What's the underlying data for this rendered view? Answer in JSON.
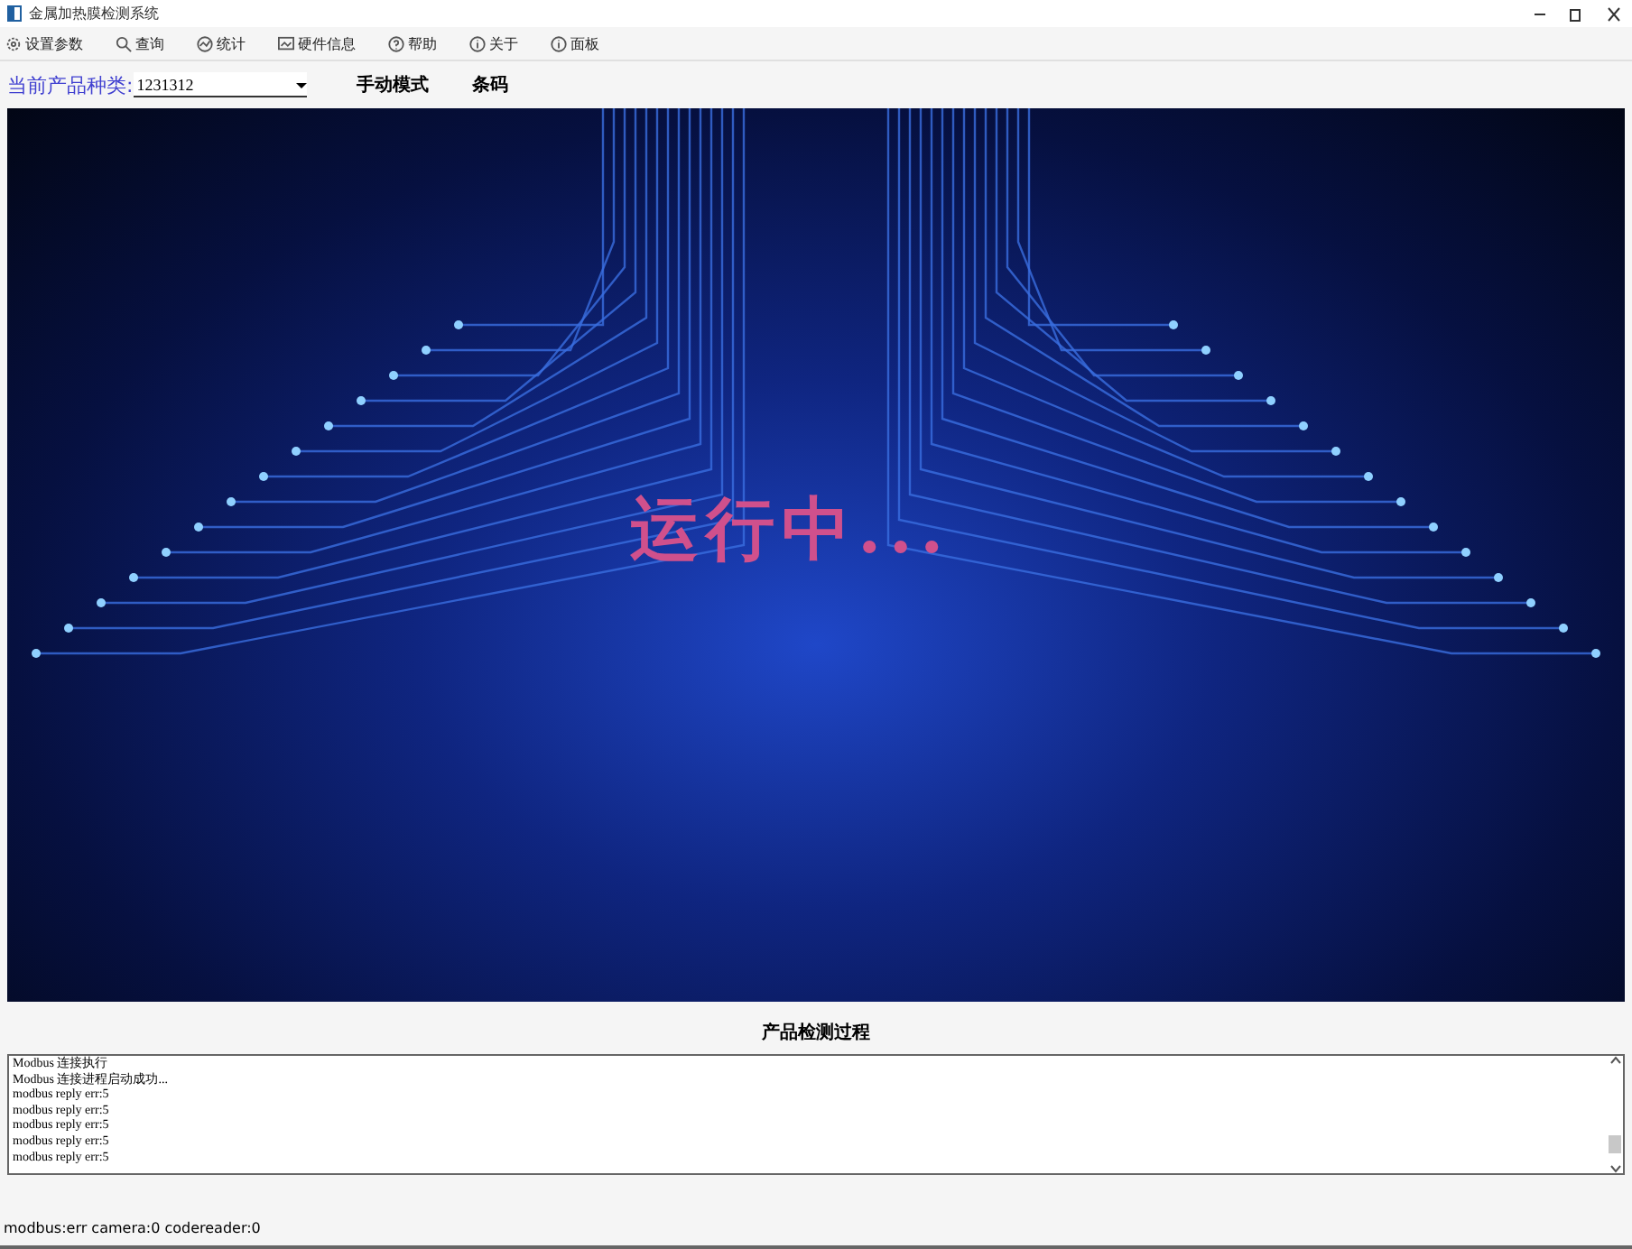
{
  "window": {
    "title": "金属加热膜检测系统"
  },
  "menu": [
    {
      "label": "设置参数",
      "kind": "gear"
    },
    {
      "label": "查询",
      "kind": "search"
    },
    {
      "label": "统计",
      "kind": "chart"
    },
    {
      "label": "硬件信息",
      "kind": "hardware"
    },
    {
      "label": "帮助",
      "kind": "help"
    },
    {
      "label": "关于",
      "kind": "info"
    },
    {
      "label": "面板",
      "kind": "info"
    }
  ],
  "product": {
    "label": "当前产品种类:",
    "value": "1231312"
  },
  "mode_label": "手动模式",
  "barcode_label": "条码",
  "display": {
    "status": "运行中..."
  },
  "log": {
    "title": "产品检测过程",
    "lines": [
      "Modbus 连接执行",
      "Modbus 连接进程启动成功...",
      "modbus reply err:5",
      "modbus reply err:5",
      "modbus reply err:5",
      "modbus reply err:5",
      "modbus reply err:5"
    ]
  },
  "status_bar": "modbus:err camera:0 codereader:0"
}
